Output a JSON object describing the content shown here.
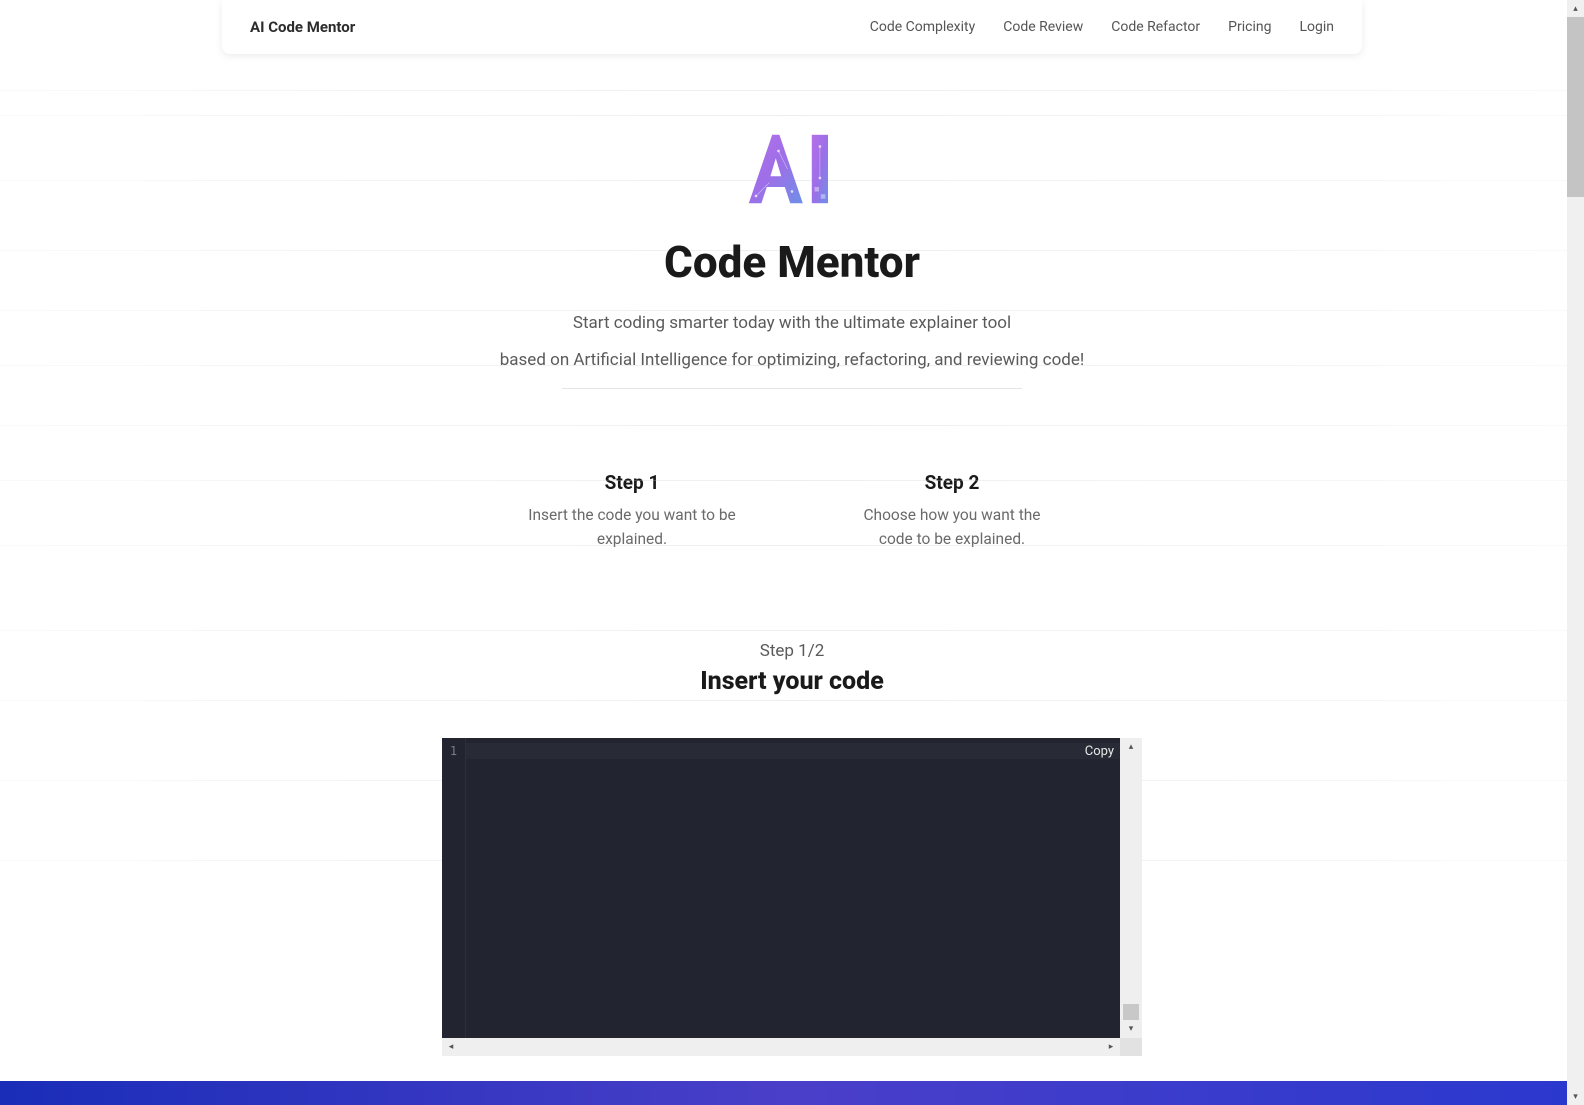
{
  "header": {
    "brand": "AI Code Mentor",
    "nav": [
      {
        "label": "Code Complexity"
      },
      {
        "label": "Code Review"
      },
      {
        "label": "Code Refactor"
      },
      {
        "label": "Pricing"
      },
      {
        "label": "Login"
      }
    ]
  },
  "hero": {
    "title": "Code Mentor",
    "sub_line1": "Start coding smarter today with the ultimate explainer tool",
    "sub_line2": "based on Artificial Intelligence for optimizing, refactoring, and reviewing code!"
  },
  "steps": [
    {
      "title": "Step 1",
      "desc": "Insert the code you want to be explained."
    },
    {
      "title": "Step 2",
      "desc": "Choose how you want the code to be explained."
    }
  ],
  "editor_section": {
    "indicator": "Step 1/2",
    "heading": "Insert your code",
    "copy_label": "Copy",
    "line_number": "1"
  }
}
